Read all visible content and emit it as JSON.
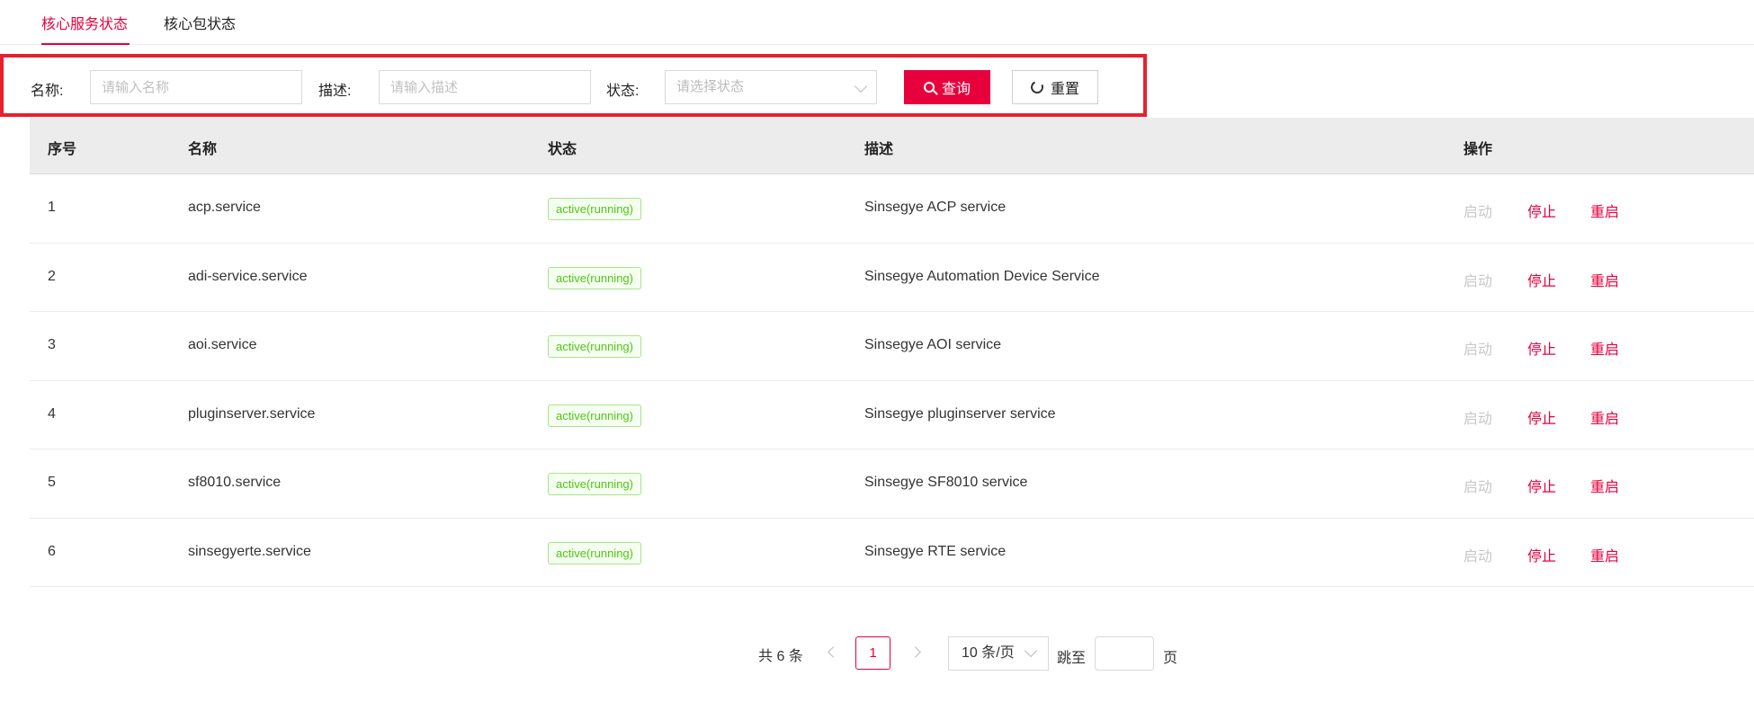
{
  "tabs": [
    {
      "label": "核心服务状态",
      "active": true
    },
    {
      "label": "核心包状态",
      "active": false
    }
  ],
  "filter": {
    "name_label": "名称:",
    "name_placeholder": "请输入名称",
    "desc_label": "描述:",
    "desc_placeholder": "请输入描述",
    "status_label": "状态:",
    "status_placeholder": "请选择状态",
    "search_button": "查询",
    "reset_button": "重置"
  },
  "table": {
    "headers": {
      "index": "序号",
      "name": "名称",
      "status": "状态",
      "desc": "描述",
      "actions": "操作"
    },
    "rows": [
      {
        "index": "1",
        "name": "acp.service",
        "status": "active(running)",
        "desc": "Sinsegye ACP service",
        "start": "启动",
        "stop": "停止",
        "restart": "重启"
      },
      {
        "index": "2",
        "name": "adi-service.service",
        "status": "active(running)",
        "desc": "Sinsegye Automation Device Service",
        "start": "启动",
        "stop": "停止",
        "restart": "重启"
      },
      {
        "index": "3",
        "name": "aoi.service",
        "status": "active(running)",
        "desc": "Sinsegye AOI service",
        "start": "启动",
        "stop": "停止",
        "restart": "重启"
      },
      {
        "index": "4",
        "name": "pluginserver.service",
        "status": "active(running)",
        "desc": "Sinsegye pluginserver service",
        "start": "启动",
        "stop": "停止",
        "restart": "重启"
      },
      {
        "index": "5",
        "name": "sf8010.service",
        "status": "active(running)",
        "desc": "Sinsegye SF8010 service",
        "start": "启动",
        "stop": "停止",
        "restart": "重启"
      },
      {
        "index": "6",
        "name": "sinsegyerte.service",
        "status": "active(running)",
        "desc": "Sinsegye RTE service",
        "start": "启动",
        "stop": "停止",
        "restart": "重启"
      }
    ]
  },
  "pagination": {
    "total": "共 6 条",
    "current_page": "1",
    "page_size": "10 条/页",
    "jump_label": "跳至",
    "page_word": "页"
  },
  "colors": {
    "accent": "#e8003d",
    "success": "#52c41a",
    "highlight_border": "#e8202e"
  }
}
